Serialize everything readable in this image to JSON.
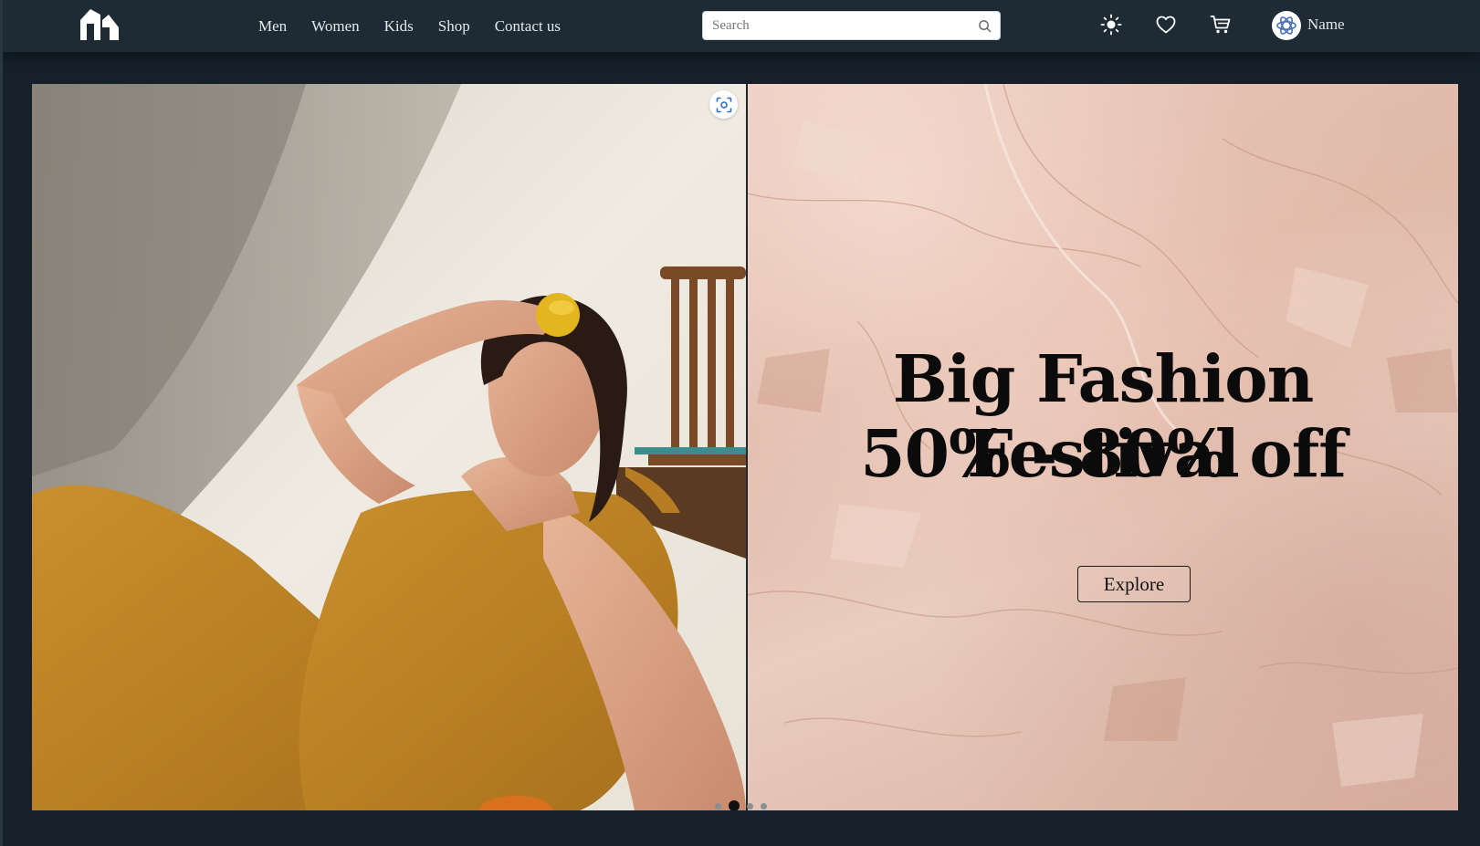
{
  "header": {
    "nav": [
      {
        "label": "Men"
      },
      {
        "label": "Women"
      },
      {
        "label": "Kids"
      },
      {
        "label": "Shop"
      },
      {
        "label": "Contact us"
      }
    ],
    "search": {
      "placeholder": "Search",
      "value": ""
    },
    "icons": [
      "sun-icon",
      "heart-icon",
      "cart-icon"
    ],
    "user": {
      "name": "Name"
    }
  },
  "hero": {
    "title": "Big Fashion Festival",
    "subtitle": "50% - 80% off",
    "cta_label": "Explore",
    "carousel": {
      "count": 4,
      "active": 2
    }
  },
  "colors": {
    "header_bg": "#1e2a34",
    "page_bg": "#15202a",
    "promo_bg": "#e6c4b5",
    "text_light": "#e6e9ec"
  }
}
